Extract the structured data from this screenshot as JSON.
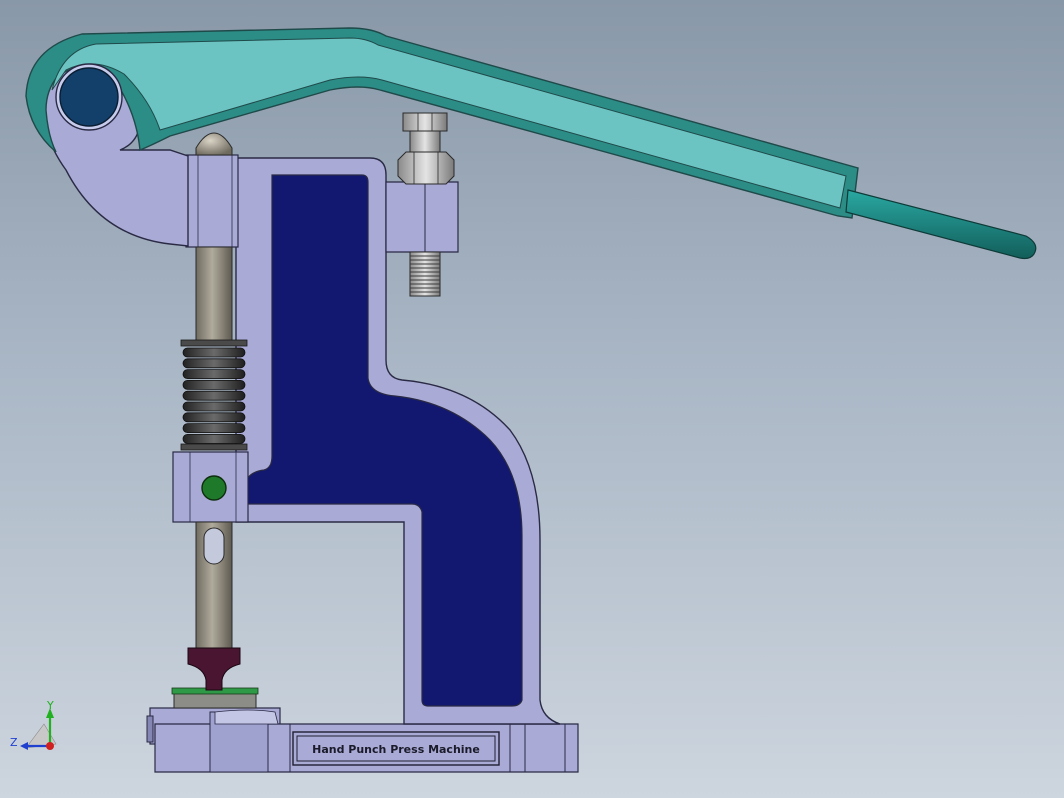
{
  "viewport": {
    "background_top": "#8998a8",
    "background_bottom": "#cdd5de"
  },
  "model": {
    "plate_label": "Hand Punch Press Machine",
    "colors": {
      "frame": "#a9abd6",
      "frame_edge": "#2a2a45",
      "frame_section": "#121870",
      "handle": "#6cc4c2",
      "handle_edge": "#1f5a5a",
      "handle_grip": "#1f8c88",
      "pivot_pin": "#13406a",
      "shaft": "#8e8a7e",
      "spring": "#3a3a3a",
      "nut": "#c8c8c8",
      "detent_ball": "#1e7a2a",
      "punch_tip": "#4a1530"
    }
  },
  "triad": {
    "x_label": "",
    "y_label": "Y",
    "z_label": "Z",
    "x_color": "#d02020",
    "y_color": "#20b020",
    "z_color": "#2040d0"
  }
}
